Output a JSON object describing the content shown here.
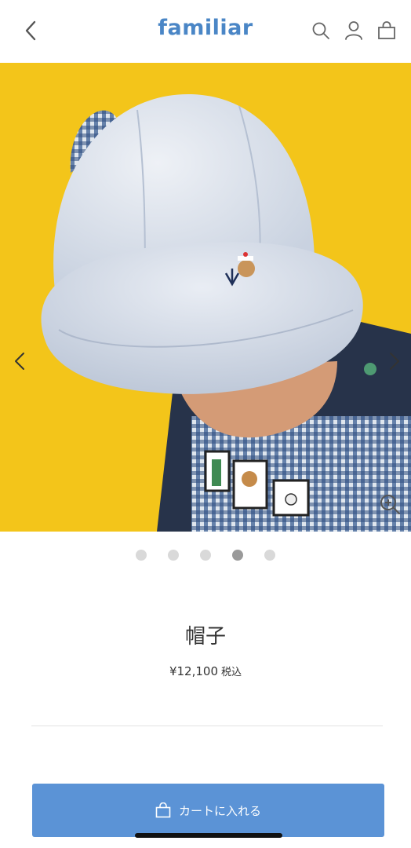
{
  "header": {
    "logo": "familiar",
    "icons": [
      "back-icon",
      "search-icon",
      "account-icon",
      "bag-icon"
    ]
  },
  "gallery": {
    "slide_count": 5,
    "active_index": 3,
    "icons": [
      "chevron-left-icon",
      "chevron-right-icon",
      "zoom-in-icon"
    ]
  },
  "product": {
    "name": "帽子",
    "price": "¥12,100",
    "tax_label": "税込"
  },
  "cart_button": {
    "label": "カートに入れる",
    "icon": "bag-icon"
  },
  "colors": {
    "brand": "#4a86c6",
    "button": "#5b93d6",
    "photo_background": "#f3c51a"
  }
}
